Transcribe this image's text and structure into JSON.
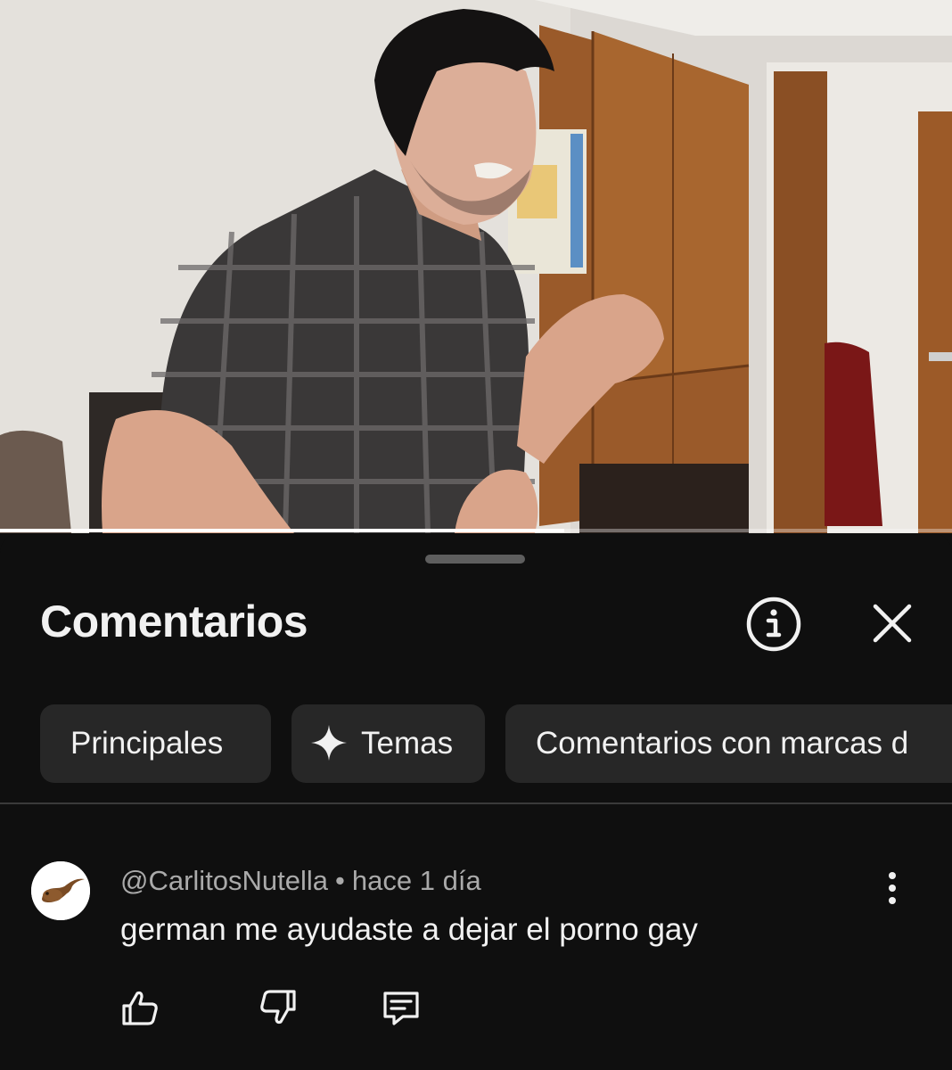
{
  "video": {
    "progress_fraction": 0.593
  },
  "sheet": {
    "title": "Comentarios",
    "info_icon": "info-circle-icon",
    "close_icon": "close-icon",
    "chips": [
      {
        "label": "Principales",
        "selected": false
      },
      {
        "label": "Temas",
        "icon": "sparkle-icon"
      },
      {
        "label": "Comentarios con marcas d"
      }
    ]
  },
  "comment": {
    "author": "@CarlitosNutella",
    "separator": "•",
    "time": "hace 1 día",
    "text": "german me ayudaste a dejar el porno gay",
    "actions": {
      "like_icon": "thumbs-up-icon",
      "dislike_icon": "thumbs-down-icon",
      "reply_icon": "reply-comment-icon"
    }
  },
  "colors": {
    "background": "#0f0f0f",
    "chip_bg": "#272727",
    "text_primary": "#f1f1f1",
    "text_secondary": "#aaaaaa"
  }
}
